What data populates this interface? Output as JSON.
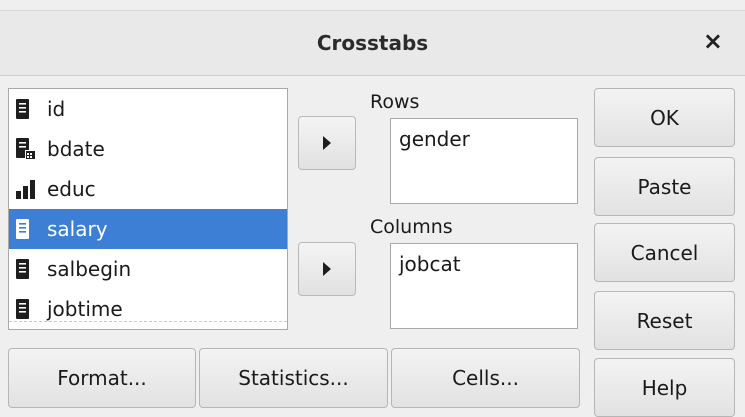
{
  "dialog": {
    "title": "Crosstabs",
    "close_glyph": "×"
  },
  "variables": [
    {
      "label": "id",
      "icon": "scale-doc-icon",
      "selected": false
    },
    {
      "label": "bdate",
      "icon": "date-doc-icon",
      "selected": false
    },
    {
      "label": "educ",
      "icon": "ordinal-bars-icon",
      "selected": false
    },
    {
      "label": "salary",
      "icon": "scale-doc-icon",
      "selected": true
    },
    {
      "label": "salbegin",
      "icon": "scale-doc-icon",
      "selected": false
    },
    {
      "label": "jobtime",
      "icon": "scale-doc-icon",
      "selected": false
    }
  ],
  "rows": {
    "label": "Rows",
    "value": "gender"
  },
  "columns": {
    "label": "Columns",
    "value": "jobcat"
  },
  "side_buttons": {
    "ok": "OK",
    "paste": "Paste",
    "cancel": "Cancel",
    "reset": "Reset",
    "help": "Help"
  },
  "bottom_buttons": {
    "format": "Format...",
    "statistics": "Statistics...",
    "cells": "Cells..."
  },
  "colors": {
    "selection": "#3d7fd4",
    "background": "#efefef"
  }
}
